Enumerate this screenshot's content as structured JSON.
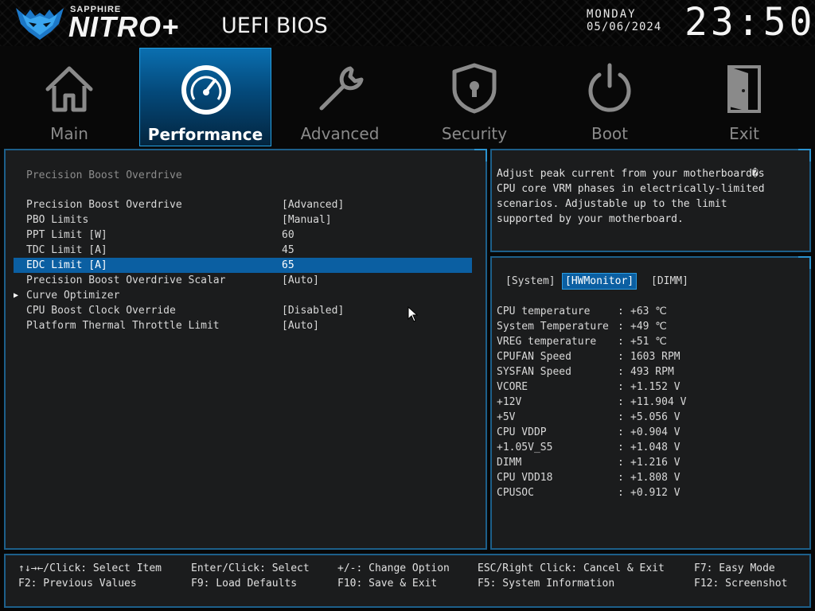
{
  "header": {
    "brand_sub": "SAPPHIRE",
    "brand_main": "NITRO+",
    "title": "UEFI BIOS",
    "day": "MONDAY",
    "date": "05/06/2024",
    "time": "23:50"
  },
  "nav": {
    "items": [
      {
        "label": "Main",
        "icon": "house-icon"
      },
      {
        "label": "Performance",
        "icon": "speedometer-icon"
      },
      {
        "label": "Advanced",
        "icon": "wrench-icon"
      },
      {
        "label": "Security",
        "icon": "shield-lock-icon"
      },
      {
        "label": "Boot",
        "icon": "power-icon"
      },
      {
        "label": "Exit",
        "icon": "door-icon"
      }
    ],
    "active": "Performance"
  },
  "settings": {
    "section_title": "Precision Boost Overdrive",
    "rows": [
      {
        "label": "Precision Boost Overdrive",
        "value": "[Advanced]"
      },
      {
        "label": "PBO Limits",
        "value": "[Manual]"
      },
      {
        "label": "PPT Limit [W]",
        "value": "60"
      },
      {
        "label": "TDC Limit [A]",
        "value": "45"
      },
      {
        "label": "EDC Limit [A]",
        "value": "65"
      },
      {
        "label": "Precision Boost Overdrive Scalar",
        "value": "[Auto]"
      },
      {
        "label": "Curve Optimizer",
        "value": ""
      },
      {
        "label": "CPU Boost Clock Override",
        "value": "[Disabled]"
      },
      {
        "label": "Platform Thermal Throttle Limit",
        "value": "[Auto]"
      }
    ],
    "selected_index": 4
  },
  "help": {
    "text": "Adjust peak current from your motherboard�s\nCPU core VRM phases in electrically-limited\nscenarios. Adjustable up to the limit\nsupported by your motherboard."
  },
  "monitor": {
    "tabs": [
      "[System]",
      "[HWMonitor]",
      "[DIMM]"
    ],
    "active_tab": "[HWMonitor]",
    "separator": ":",
    "rows": [
      {
        "label": "CPU temperature",
        "value": "+63 ℃"
      },
      {
        "label": "System Temperature",
        "value": "+49 ℃"
      },
      {
        "label": "VREG temperature",
        "value": "+51 ℃"
      },
      {
        "label": "CPUFAN Speed",
        "value": "1603 RPM"
      },
      {
        "label": "SYSFAN Speed",
        "value": "493 RPM"
      },
      {
        "label": "VCORE",
        "value": "+1.152 V"
      },
      {
        "label": "+12V",
        "value": "+11.904 V"
      },
      {
        "label": "+5V",
        "value": "+5.056 V"
      },
      {
        "label": "CPU VDDP",
        "value": "+0.904 V"
      },
      {
        "label": "+1.05V_S5",
        "value": "+1.048 V"
      },
      {
        "label": "DIMM",
        "value": "+1.216 V"
      },
      {
        "label": "CPU VDD18",
        "value": "+1.808 V"
      },
      {
        "label": "CPUSOC",
        "value": "+0.912 V"
      }
    ]
  },
  "footer": {
    "hints_row1": [
      "↑↓→←/Click: Select Item",
      "Enter/Click: Select",
      "+/-: Change Option",
      "ESC/Right Click: Cancel & Exit",
      "F7: Easy Mode"
    ],
    "hints_row2": [
      "F2: Previous Values",
      "F9: Load Defaults",
      "F10: Save & Exit",
      "F5: System Information",
      "F12: Screenshot"
    ]
  },
  "colors": {
    "accent": "#0b5fa2",
    "border": "#1d5f8a",
    "panel_bg": "#1b1c1d",
    "logo_blue": "#2a8ee0"
  }
}
